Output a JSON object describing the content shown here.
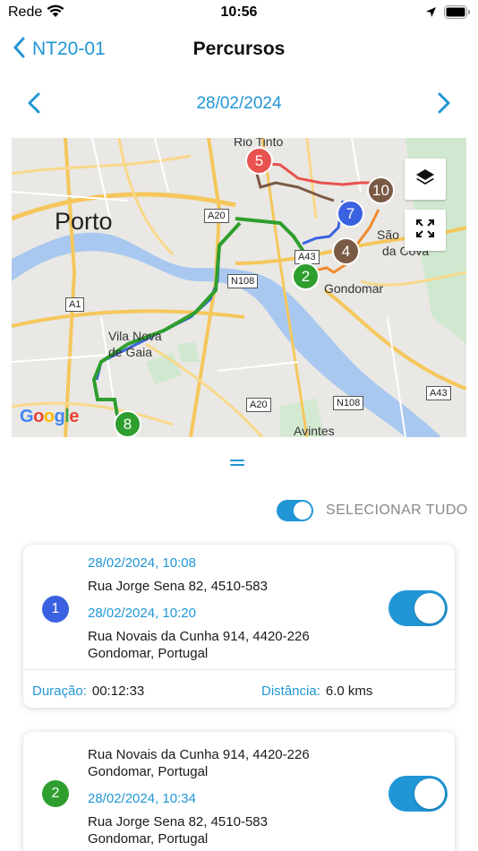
{
  "status_bar": {
    "carrier": "Rede",
    "time": "10:56"
  },
  "nav": {
    "back_label": "NT20-01",
    "title": "Percursos"
  },
  "date_nav": {
    "date": "28/02/2024"
  },
  "map": {
    "city_label": "Porto",
    "labels": [
      "Rio Tinto",
      "Vila Nova",
      "de Gaia",
      "São",
      "da Cova",
      "Gondomar",
      "Avintes"
    ],
    "road_shields": [
      "A20",
      "A43",
      "N108",
      "A1",
      "A20",
      "N108",
      "A43"
    ],
    "pins": [
      "5",
      "10",
      "7",
      "4",
      "2",
      "8"
    ],
    "pin_colors": {
      "red": "#e8524f",
      "brown": "#7a5a45",
      "blue": "#3a62e0",
      "green": "#2e9e2e"
    },
    "attribution": "Google"
  },
  "select_all": {
    "label": "SELECIONAR TUDO"
  },
  "routes": [
    {
      "number": "1",
      "color": "#3a62e0",
      "start_time": "28/02/2024, 10:08",
      "start_address": "Rua Jorge Sena 82, 4510-583",
      "end_time": "28/02/2024, 10:20",
      "end_address_line1": "Rua Novais da Cunha 914, 4420-226",
      "end_address_line2": "Gondomar, Portugal",
      "duration_label": "Duração:",
      "duration_value": "00:12:33",
      "distance_label": "Distância:",
      "distance_value": "6.0 kms"
    },
    {
      "number": "2",
      "color": "#2e9e2e",
      "start_address_line1": "Rua Novais da Cunha 914, 4420-226",
      "start_address_line2": "Gondomar, Portugal",
      "end_time": "28/02/2024, 10:34",
      "end_address_line1": "Rua Jorge Sena 82, 4510-583",
      "end_address_line2": "Gondomar, Portugal"
    }
  ],
  "colors": {
    "accent": "#2196d6"
  }
}
